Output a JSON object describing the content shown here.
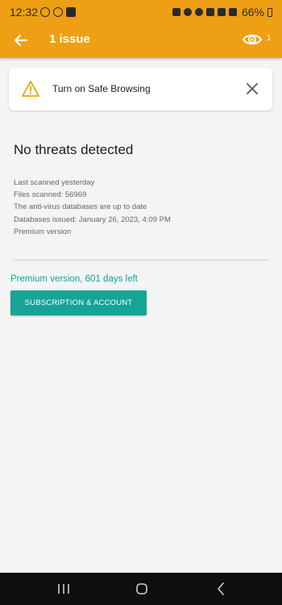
{
  "status_bar": {
    "time": "12:32",
    "battery": "66%"
  },
  "app_bar": {
    "title": "1 issue",
    "eye_count": "1"
  },
  "card": {
    "text": "Turn on Safe Browsing"
  },
  "main": {
    "title": "No threats detected",
    "info": [
      "Last scanned yesterday",
      "Files scanned: 56969",
      "The anti-virus databases are up to date",
      "Databases issued: January 26, 2023, 4:09 PM",
      "Premium version"
    ],
    "premium_text": "Premium version, 601 days left",
    "subscription_button": "SUBSCRIPTION & ACCOUNT"
  },
  "colors": {
    "header": "#ef9f13",
    "accent": "#16a594",
    "warning": "#e6a700"
  },
  "icons": {
    "back": "arrow-left-icon",
    "eye": "eye-icon",
    "warning": "warning-triangle-icon",
    "close": "close-icon",
    "nav_recent": "recent-apps-icon",
    "nav_home": "home-icon",
    "nav_back": "back-icon"
  }
}
